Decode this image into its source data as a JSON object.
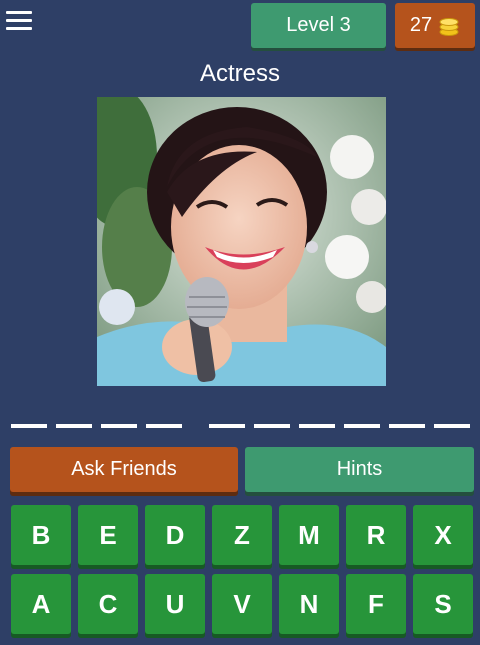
{
  "header": {
    "level_label": "Level 3",
    "coins": "27",
    "coin_icon": "coins-icon",
    "menu_icon": "hamburger-menu-icon"
  },
  "category": "Actress",
  "answer_slots": {
    "word_lengths": [
      4,
      6
    ]
  },
  "actions": {
    "ask_friends": "Ask Friends",
    "hints": "Hints"
  },
  "keyboard": {
    "row1": [
      "B",
      "E",
      "D",
      "Z",
      "M",
      "R",
      "X"
    ],
    "row2": [
      "A",
      "C",
      "U",
      "V",
      "N",
      "F",
      "S"
    ]
  },
  "colors": {
    "background": "#2e3f66",
    "green_button": "#3e9a70",
    "orange_button": "#b5531c",
    "key_green": "#27953a"
  }
}
